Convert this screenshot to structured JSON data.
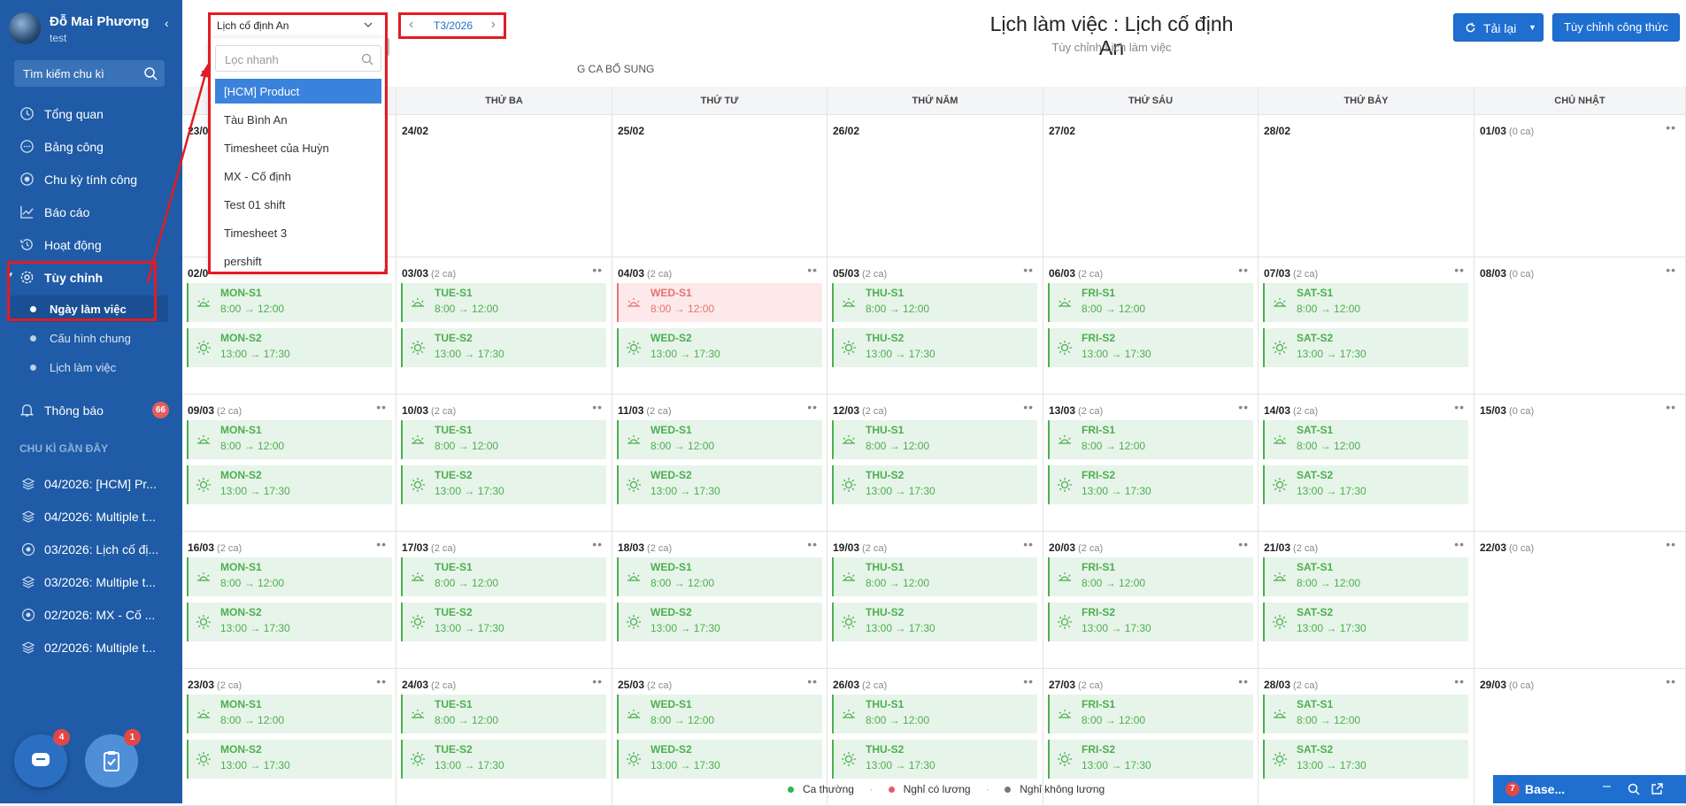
{
  "user": {
    "name": "Đỗ Mai Phương",
    "subtitle": "test"
  },
  "sidebar": {
    "search_label": "Tìm kiếm chu kì",
    "items": [
      {
        "label": "Tổng quan",
        "icon": "clock-icon"
      },
      {
        "label": "Bảng công",
        "icon": "chat-icon"
      },
      {
        "label": "Chu kỳ tính công",
        "icon": "target-icon"
      },
      {
        "label": "Báo cáo",
        "icon": "chart-icon"
      },
      {
        "label": "Hoạt động",
        "icon": "history-icon"
      },
      {
        "label": "Tùy chỉnh",
        "icon": "gear-icon"
      }
    ],
    "subitems": [
      {
        "label": "Ngày làm việc",
        "active": true
      },
      {
        "label": "Cấu hình chung",
        "active": false
      },
      {
        "label": "Lịch làm việc",
        "active": false
      }
    ],
    "notifications": {
      "label": "Thông báo",
      "count": "66"
    },
    "recent_title": "CHU KÌ GẦN ĐÂY",
    "recent": [
      {
        "label": "04/2026: [HCM] Pr...",
        "icon": "layers-icon"
      },
      {
        "label": "04/2026: Multiple t...",
        "icon": "layers-icon"
      },
      {
        "label": "03/2026: Lịch cố đị...",
        "icon": "target-icon"
      },
      {
        "label": "03/2026: Multiple t...",
        "icon": "layers-icon"
      },
      {
        "label": "02/2026: MX - Cố ...",
        "icon": "target-icon"
      },
      {
        "label": "02/2026: Multiple t...",
        "icon": "layers-icon"
      }
    ],
    "fab_chat_badge": "4",
    "fab_task_badge": "1"
  },
  "header": {
    "schedule_select": "Lịch cố định An",
    "month": "T3/2026",
    "title": "Lịch làm việc : Lịch cố định An",
    "subtitle": "Tùy chỉnh Lịch làm việc",
    "reload_label": "Tải lại",
    "formula_label": "Tùy chỉnh công thức",
    "tab_partial": "G CA BỔ SUNG"
  },
  "dropdown": {
    "placeholder": "Lọc nhanh",
    "options": [
      "[HCM] Product",
      "Tàu Bình An",
      "Timesheet của Huỳn",
      "MX - Cố định",
      "Test 01 shift",
      "Timesheet 3",
      "pershift"
    ],
    "selected_index": 0
  },
  "calendar": {
    "weekdays": [
      "THỨ HAI",
      "THỨ BA",
      "THỨ TƯ",
      "THỨ NĂM",
      "THỨ SÁU",
      "THỨ BẢY",
      "CHỦ NHẬT"
    ],
    "rows": [
      [
        {
          "date": "23/0",
          "count": ""
        },
        {
          "date": "24/02",
          "count": ""
        },
        {
          "date": "25/02",
          "count": ""
        },
        {
          "date": "26/02",
          "count": ""
        },
        {
          "date": "27/02",
          "count": ""
        },
        {
          "date": "28/02",
          "count": ""
        },
        {
          "date": "01/03",
          "count": "(0 ca)"
        }
      ],
      [
        {
          "date": "02/0",
          "count": "",
          "shifts": [
            {
              "name": "MON-S1",
              "time": "8:00 → 12:00"
            },
            {
              "name": "MON-S2",
              "time": "13:00 → 17:30"
            }
          ]
        },
        {
          "date": "03/03",
          "count": "(2 ca)",
          "shifts": [
            {
              "name": "TUE-S1",
              "time": "8:00 → 12:00"
            },
            {
              "name": "TUE-S2",
              "time": "13:00 → 17:30"
            }
          ]
        },
        {
          "date": "04/03",
          "count": "(2 ca)",
          "shifts": [
            {
              "name": "WED-S1",
              "time": "8:00 → 12:00",
              "type": "red"
            },
            {
              "name": "WED-S2",
              "time": "13:00 → 17:30"
            }
          ]
        },
        {
          "date": "05/03",
          "count": "(2 ca)",
          "shifts": [
            {
              "name": "THU-S1",
              "time": "8:00 → 12:00"
            },
            {
              "name": "THU-S2",
              "time": "13:00 → 17:30"
            }
          ]
        },
        {
          "date": "06/03",
          "count": "(2 ca)",
          "shifts": [
            {
              "name": "FRI-S1",
              "time": "8:00 → 12:00"
            },
            {
              "name": "FRI-S2",
              "time": "13:00 → 17:30"
            }
          ]
        },
        {
          "date": "07/03",
          "count": "(2 ca)",
          "shifts": [
            {
              "name": "SAT-S1",
              "time": "8:00 → 12:00"
            },
            {
              "name": "SAT-S2",
              "time": "13:00 → 17:30"
            }
          ]
        },
        {
          "date": "08/03",
          "count": "(0 ca)",
          "shifts": []
        }
      ],
      [
        {
          "date": "09/03",
          "count": "(2 ca)",
          "shifts": [
            {
              "name": "MON-S1",
              "time": "8:00 → 12:00"
            },
            {
              "name": "MON-S2",
              "time": "13:00 → 17:30"
            }
          ]
        },
        {
          "date": "10/03",
          "count": "(2 ca)",
          "shifts": [
            {
              "name": "TUE-S1",
              "time": "8:00 → 12:00"
            },
            {
              "name": "TUE-S2",
              "time": "13:00 → 17:30"
            }
          ]
        },
        {
          "date": "11/03",
          "count": "(2 ca)",
          "shifts": [
            {
              "name": "WED-S1",
              "time": "8:00 → 12:00"
            },
            {
              "name": "WED-S2",
              "time": "13:00 → 17:30"
            }
          ]
        },
        {
          "date": "12/03",
          "count": "(2 ca)",
          "shifts": [
            {
              "name": "THU-S1",
              "time": "8:00 → 12:00"
            },
            {
              "name": "THU-S2",
              "time": "13:00 → 17:30"
            }
          ]
        },
        {
          "date": "13/03",
          "count": "(2 ca)",
          "shifts": [
            {
              "name": "FRI-S1",
              "time": "8:00 → 12:00"
            },
            {
              "name": "FRI-S2",
              "time": "13:00 → 17:30"
            }
          ]
        },
        {
          "date": "14/03",
          "count": "(2 ca)",
          "shifts": [
            {
              "name": "SAT-S1",
              "time": "8:00 → 12:00"
            },
            {
              "name": "SAT-S2",
              "time": "13:00 → 17:30"
            }
          ]
        },
        {
          "date": "15/03",
          "count": "(0 ca)",
          "shifts": []
        }
      ],
      [
        {
          "date": "16/03",
          "count": "(2 ca)",
          "shifts": [
            {
              "name": "MON-S1",
              "time": "8:00 → 12:00"
            },
            {
              "name": "MON-S2",
              "time": "13:00 → 17:30"
            }
          ]
        },
        {
          "date": "17/03",
          "count": "(2 ca)",
          "shifts": [
            {
              "name": "TUE-S1",
              "time": "8:00 → 12:00"
            },
            {
              "name": "TUE-S2",
              "time": "13:00 → 17:30"
            }
          ]
        },
        {
          "date": "18/03",
          "count": "(2 ca)",
          "shifts": [
            {
              "name": "WED-S1",
              "time": "8:00 → 12:00"
            },
            {
              "name": "WED-S2",
              "time": "13:00 → 17:30"
            }
          ]
        },
        {
          "date": "19/03",
          "count": "(2 ca)",
          "shifts": [
            {
              "name": "THU-S1",
              "time": "8:00 → 12:00"
            },
            {
              "name": "THU-S2",
              "time": "13:00 → 17:30"
            }
          ]
        },
        {
          "date": "20/03",
          "count": "(2 ca)",
          "shifts": [
            {
              "name": "FRI-S1",
              "time": "8:00 → 12:00"
            },
            {
              "name": "FRI-S2",
              "time": "13:00 → 17:30"
            }
          ]
        },
        {
          "date": "21/03",
          "count": "(2 ca)",
          "shifts": [
            {
              "name": "SAT-S1",
              "time": "8:00 → 12:00"
            },
            {
              "name": "SAT-S2",
              "time": "13:00 → 17:30"
            }
          ]
        },
        {
          "date": "22/03",
          "count": "(0 ca)",
          "shifts": []
        }
      ],
      [
        {
          "date": "23/03",
          "count": "(2 ca)",
          "shifts": [
            {
              "name": "MON-S1",
              "time": "8:00 → 12:00"
            },
            {
              "name": "MON-S2",
              "time": "13:00 → 17:30"
            }
          ]
        },
        {
          "date": "24/03",
          "count": "(2 ca)",
          "shifts": [
            {
              "name": "TUE-S1",
              "time": "8:00 → 12:00"
            },
            {
              "name": "TUE-S2",
              "time": "13:00 → 17:30"
            }
          ]
        },
        {
          "date": "25/03",
          "count": "(2 ca)",
          "shifts": [
            {
              "name": "WED-S1",
              "time": "8:00 → 12:00"
            },
            {
              "name": "WED-S2",
              "time": "13:00 → 17:30"
            }
          ]
        },
        {
          "date": "26/03",
          "count": "(2 ca)",
          "shifts": [
            {
              "name": "THU-S1",
              "time": "8:00 → 12:00"
            },
            {
              "name": "THU-S2",
              "time": "13:00 → 17:30"
            }
          ]
        },
        {
          "date": "27/03",
          "count": "(2 ca)",
          "shifts": [
            {
              "name": "FRI-S1",
              "time": "8:00 → 12:00"
            },
            {
              "name": "FRI-S2",
              "time": "13:00 → 17:30"
            }
          ]
        },
        {
          "date": "28/03",
          "count": "(2 ca)",
          "shifts": [
            {
              "name": "SAT-S1",
              "time": "8:00 → 12:00"
            },
            {
              "name": "SAT-S2",
              "time": "13:00 → 17:30"
            }
          ]
        },
        {
          "date": "29/03",
          "count": "(0 ca)",
          "shifts": []
        }
      ]
    ]
  },
  "legend": [
    {
      "label": "Ca thường",
      "color": "#2db84d"
    },
    {
      "label": "Nghỉ có lương",
      "color": "#e85a6b"
    },
    {
      "label": "Nghỉ không lương",
      "color": "#777777"
    }
  ],
  "widget": {
    "label": "Base...",
    "badge": "7"
  },
  "colors": {
    "sidebar": "#1f5ba6",
    "accent": "#1f6fd1",
    "shift_green": "#4caf50",
    "highlight_red": "#e31b23"
  }
}
